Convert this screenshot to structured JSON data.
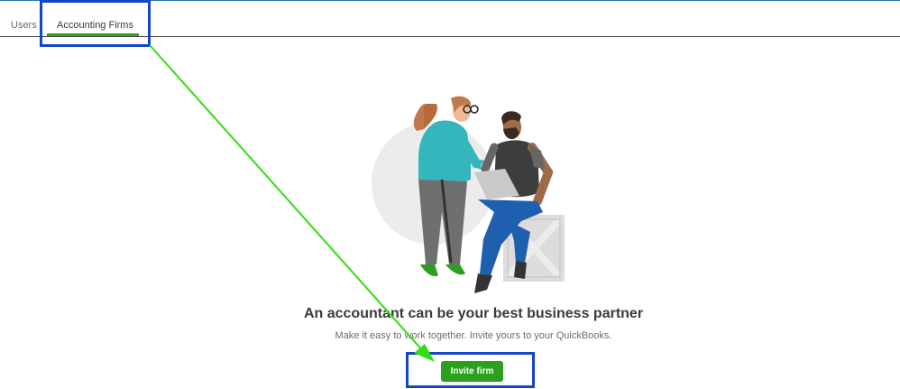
{
  "tabs": {
    "items": [
      {
        "label": "Users",
        "active": false
      },
      {
        "label": "Accounting Firms",
        "active": true
      }
    ]
  },
  "empty_state": {
    "illustration": "accountant-partners-illustration",
    "headline": "An accountant can be your best business partner",
    "subtext": "Make it easy to work together. Invite yours to your QuickBooks.",
    "invite_button_label": "Invite firm"
  },
  "annotations": {
    "box_color": "#1346c9",
    "arrow_color": "#33dd11"
  },
  "colors": {
    "accent": "#2ca01c",
    "text": "#393a3d",
    "muted": "#6b6c72"
  }
}
